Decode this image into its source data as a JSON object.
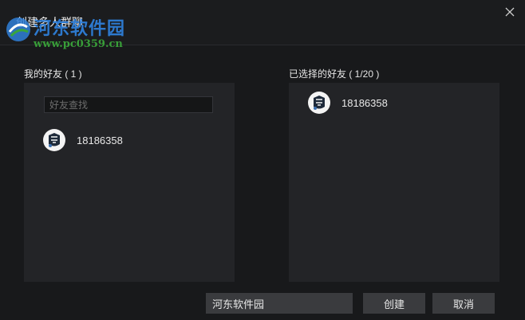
{
  "window": {
    "title": "创建多人群聊",
    "close_icon": "close-icon"
  },
  "watermark": {
    "brand": "河东软件园",
    "url": "www.pc0359.cn",
    "brand_color": "#2f7fd8",
    "url_color": "#3aa63a"
  },
  "my_friends": {
    "label": "我的好友 ( 1 )",
    "search_placeholder": "好友查找",
    "items": [
      {
        "name": "18186358",
        "avatar_icon": "avatar-icon"
      }
    ]
  },
  "selected_friends": {
    "label": "已选择的好友 ( 1/20 )",
    "items": [
      {
        "name": "18186358",
        "avatar_icon": "avatar-icon"
      }
    ]
  },
  "footer": {
    "group_name_value": "河东软件园",
    "create_label": "创建",
    "cancel_label": "取消"
  },
  "colors": {
    "background": "#18191b",
    "panel": "#232427",
    "button": "#3a3b3e",
    "text": "#e6e6e6"
  }
}
